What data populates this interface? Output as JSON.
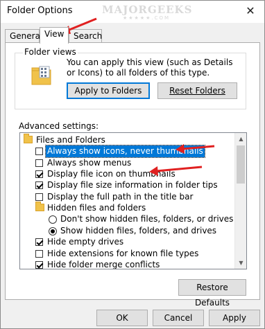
{
  "window": {
    "title": "Folder Options",
    "close_glyph": "✕"
  },
  "watermark": {
    "text": "MAJORGEEKS",
    "sub": "★★★★★.COM"
  },
  "tabs": [
    {
      "label": "General"
    },
    {
      "label": "View"
    },
    {
      "label": "Search"
    }
  ],
  "folder_views": {
    "label": "Folder views",
    "description": "You can apply this view (such as Details or Icons) to all folders of this type.",
    "apply_button": "Apply to Folders",
    "reset_button": "Reset Folders"
  },
  "advanced": {
    "label": "Advanced settings:",
    "items": [
      {
        "type": "folder",
        "label": "Files and Folders"
      },
      {
        "type": "checkbox",
        "label": "Always show icons, never thumbnails",
        "checked": false,
        "selected": true
      },
      {
        "type": "checkbox",
        "label": "Always show menus",
        "checked": false
      },
      {
        "type": "checkbox",
        "label": "Display file icon on thumbnails",
        "checked": true
      },
      {
        "type": "checkbox",
        "label": "Display file size information in folder tips",
        "checked": true
      },
      {
        "type": "checkbox",
        "label": "Display the full path in the title bar",
        "checked": false
      },
      {
        "type": "folder",
        "label": "Hidden files and folders"
      },
      {
        "type": "radio",
        "label": "Don't show hidden files, folders, or drives",
        "checked": false
      },
      {
        "type": "radio",
        "label": "Show hidden files, folders, and drives",
        "checked": true
      },
      {
        "type": "checkbox",
        "label": "Hide empty drives",
        "checked": true
      },
      {
        "type": "checkbox",
        "label": "Hide extensions for known file types",
        "checked": false
      },
      {
        "type": "checkbox",
        "label": "Hide folder merge conflicts",
        "checked": true
      }
    ]
  },
  "buttons": {
    "restore": "Restore Defaults",
    "ok": "OK",
    "cancel": "Cancel",
    "apply": "Apply"
  },
  "colors": {
    "selection": "#0078d7",
    "annotation_arrow": "#e02020",
    "folder": "#f0c24a"
  }
}
